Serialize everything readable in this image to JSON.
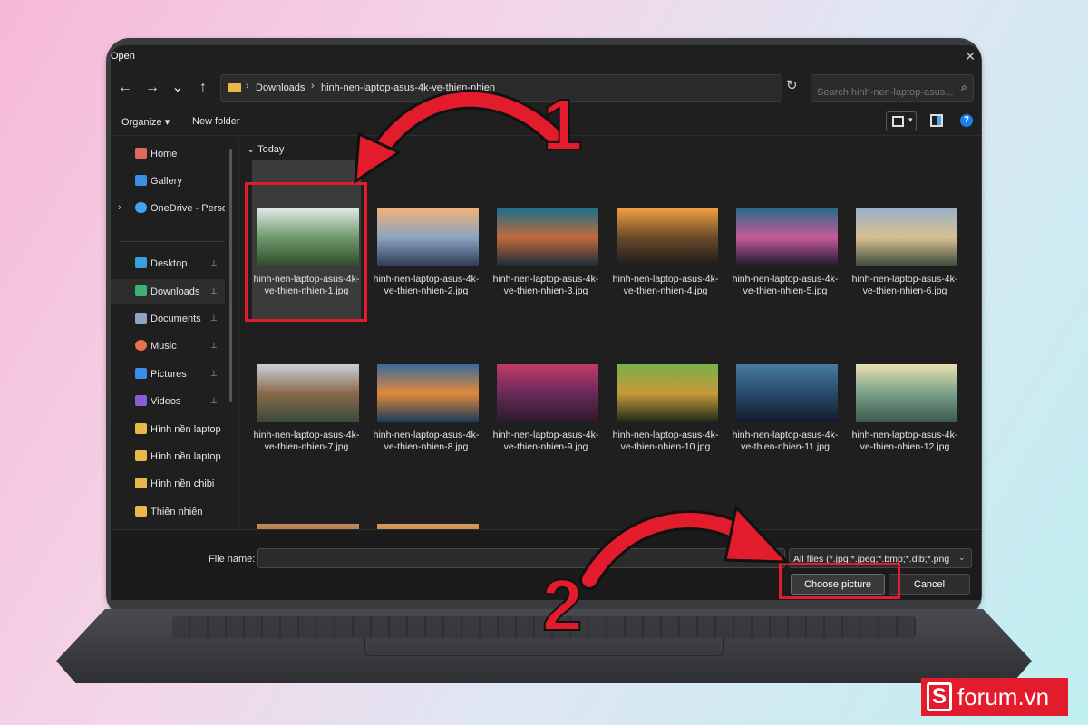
{
  "dialog": {
    "title": "Open",
    "close_glyph": "✕"
  },
  "nav": {
    "back": "←",
    "forward": "→",
    "recent": "⌄",
    "up": "↑",
    "breadcrumb": [
      "Downloads",
      "hinh-nen-laptop-asus-4k-ve-thien-nhien"
    ],
    "dropdown": "⌄",
    "refresh": "↻",
    "search_placeholder": "Search hinh-nen-laptop-asus...",
    "search_icon": "⌕"
  },
  "toolbar": {
    "organize": "Organize ▾",
    "new_folder": "New folder",
    "help": "?"
  },
  "sidebar": {
    "items": [
      {
        "label": "Home",
        "icon": "home-icon",
        "color": "#e06a5a"
      },
      {
        "label": "Gallery",
        "icon": "gallery-icon",
        "color": "#3a8ee6"
      },
      {
        "label": "OneDrive - Perso",
        "icon": "cloud-icon",
        "color": "#3fa2f2"
      },
      {
        "label": "Desktop",
        "icon": "desktop-icon",
        "color": "#3aa0e0"
      },
      {
        "label": "Downloads",
        "icon": "download-icon",
        "color": "#3cb371"
      },
      {
        "label": "Documents",
        "icon": "document-icon",
        "color": "#8fa4c0"
      },
      {
        "label": "Music",
        "icon": "music-icon",
        "color": "#e8724a"
      },
      {
        "label": "Pictures",
        "icon": "pictures-icon",
        "color": "#3a8ee6"
      },
      {
        "label": "Videos",
        "icon": "video-icon",
        "color": "#8a5cd6"
      },
      {
        "label": "Hình nền laptop",
        "icon": "folder-icon",
        "color": "#e8b84a"
      },
      {
        "label": "Hình nền laptop",
        "icon": "folder-icon",
        "color": "#e8b84a"
      },
      {
        "label": "Hình nền chibi",
        "icon": "folder-icon",
        "color": "#e8b84a"
      },
      {
        "label": "Thiên nhiên",
        "icon": "folder-icon",
        "color": "#e8b84a"
      }
    ],
    "chevron": "›",
    "pin": "📌"
  },
  "content": {
    "group_header": "⌄  Today",
    "files": [
      {
        "name": "hinh-nen-laptop-asus-4k-ve-thien-nhien-1.jpg",
        "colors": [
          "#dfe8e6",
          "#6f9a6a",
          "#2f4a2e"
        ]
      },
      {
        "name": "hinh-nen-laptop-asus-4k-ve-thien-nhien-2.jpg",
        "colors": [
          "#f0b27a",
          "#8aa4c2",
          "#2e3a52"
        ]
      },
      {
        "name": "hinh-nen-laptop-asus-4k-ve-thien-nhien-3.jpg",
        "colors": [
          "#1e6f8a",
          "#c26a3a",
          "#1a2a3a"
        ]
      },
      {
        "name": "hinh-nen-laptop-asus-4k-ve-thien-nhien-4.jpg",
        "colors": [
          "#f0a040",
          "#6a4a2a",
          "#1a1a1a"
        ]
      },
      {
        "name": "hinh-nen-laptop-asus-4k-ve-thien-nhien-5.jpg",
        "colors": [
          "#2a6a8a",
          "#c85a9a",
          "#1a1a2a"
        ]
      },
      {
        "name": "hinh-nen-laptop-asus-4k-ve-thien-nhien-6.jpg",
        "colors": [
          "#9ab0c8",
          "#d8c090",
          "#3a4a3a"
        ]
      },
      {
        "name": "hinh-nen-laptop-asus-4k-ve-thien-nhien-7.jpg",
        "colors": [
          "#c8d0d8",
          "#8a6a4a",
          "#3a4a3a"
        ]
      },
      {
        "name": "hinh-nen-laptop-asus-4k-ve-thien-nhien-8.jpg",
        "colors": [
          "#3a6a9a",
          "#e08a3a",
          "#1a3a5a"
        ]
      },
      {
        "name": "hinh-nen-laptop-asus-4k-ve-thien-nhien-9.jpg",
        "colors": [
          "#c03a6a",
          "#6a2a5a",
          "#2a1a2a"
        ]
      },
      {
        "name": "hinh-nen-laptop-asus-4k-ve-thien-nhien-10.jpg",
        "colors": [
          "#7ab04a",
          "#c89a3a",
          "#1a2a1a"
        ]
      },
      {
        "name": "hinh-nen-laptop-asus-4k-ve-thien-nhien-11.jpg",
        "colors": [
          "#4a7aa0",
          "#2a4a6a",
          "#101a2a"
        ]
      },
      {
        "name": "hinh-nen-laptop-asus-4k-ve-thien-nhien-12.jpg",
        "colors": [
          "#e8e0b0",
          "#7aa08a",
          "#3a5a4a"
        ]
      }
    ],
    "partial_row_colors": [
      [
        "#c08a5a",
        "#3a2a1a"
      ],
      [
        "#d89a5a",
        "#3a3a4a"
      ]
    ]
  },
  "footer": {
    "file_name_label": "File name:",
    "file_name_value": "",
    "file_type": "All files (*.jpg;*.jpeg;*.bmp;*.dib;*.png",
    "file_type_chevron": "⌄",
    "choose_label": "Choose picture",
    "cancel_label": "Cancel"
  },
  "annotations": {
    "step1": "1",
    "step2": "2",
    "color": "#e21b2d"
  },
  "logo": {
    "mark": "S",
    "text": "forum.vn"
  }
}
